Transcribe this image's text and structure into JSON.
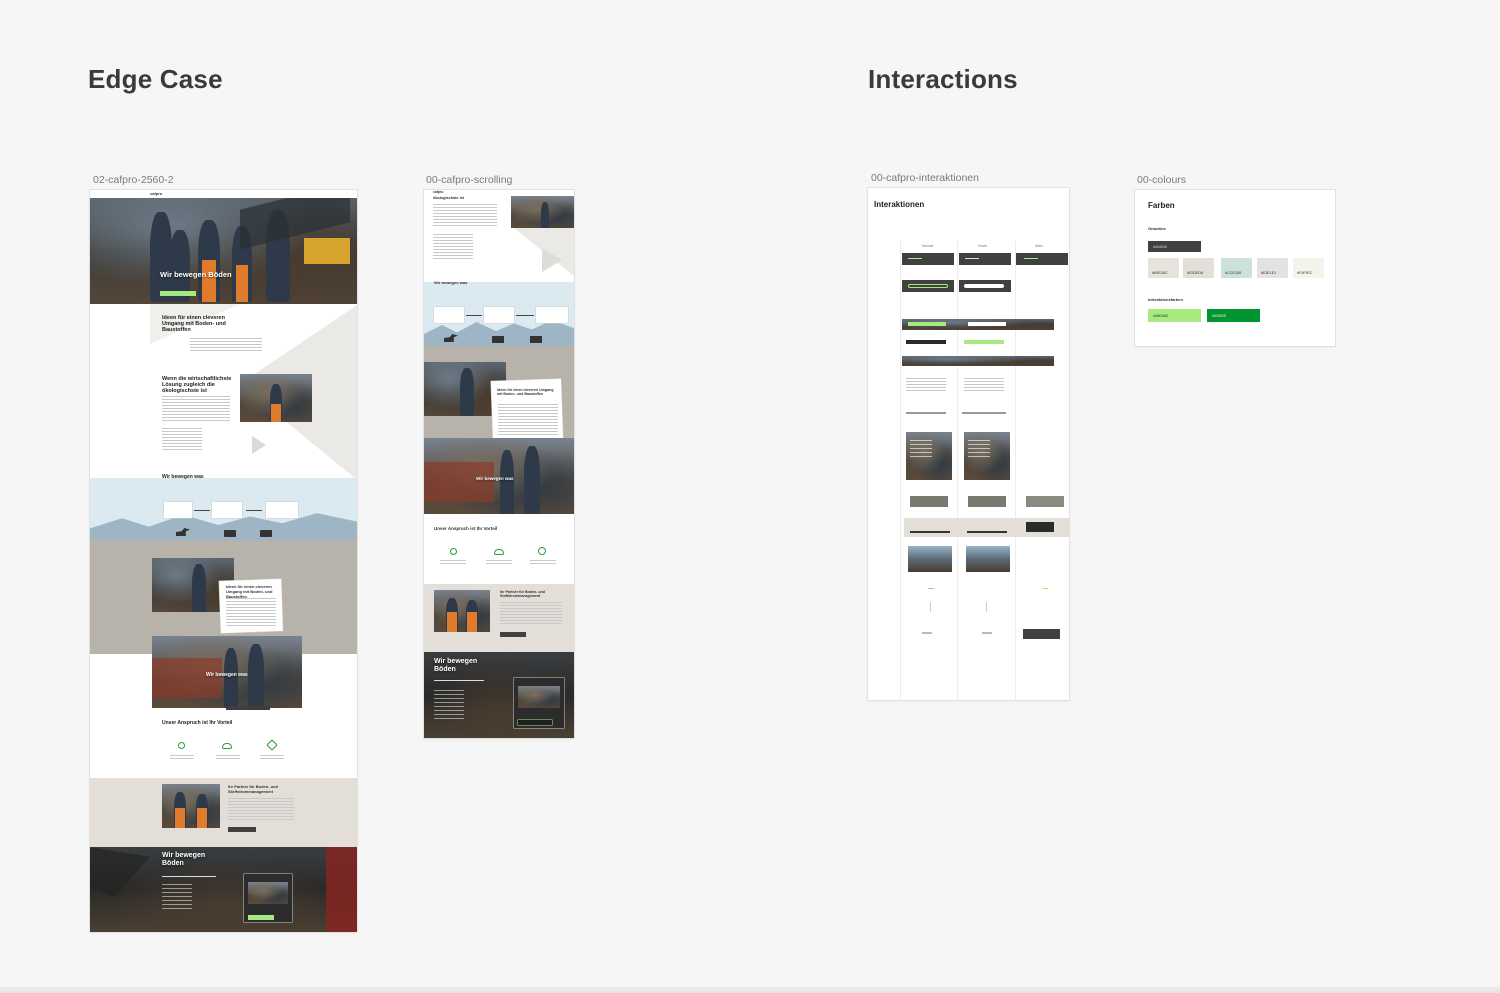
{
  "sections": {
    "edge_case": "Edge Case",
    "interactions": "Interactions"
  },
  "frames": {
    "f1": "02-cafpro-2560-2",
    "f2": "00-cafpro-scrolling",
    "f3": "00-cafpro-interaktionen",
    "f4": "00-colours"
  },
  "site": {
    "logo": "cafpro",
    "hero_title": "Wir bewegen Böden",
    "idea_heading": "Ideen für einen cleveren Umgang mit Boden- und Baustoffen",
    "econ_heading": "Wenn die wirtschaftlichste Lösung zugleich die ökologischste ist",
    "wir_bewegen_was": "Wir bewegen was",
    "anspruch": "Unser Anspruch ist Ihr Vorteil",
    "partner": "Ihr Partner für Boden- und Stoffstrommanagement",
    "footer_title": "Wir bewegen Böden",
    "scroll_heading": "ökologischste ist"
  },
  "interactions_board": {
    "title": "Interaktionen",
    "col_states": [
      "Normal",
      "Hover",
      "Aktiv"
    ]
  },
  "colours_board": {
    "title": "Farben",
    "group1": "Grautöne",
    "group2": "Interaktionsfarben",
    "greys": [
      {
        "hex": "#404040",
        "color": "#404040",
        "label": "#404040"
      },
      {
        "hex": "#E6E4DC",
        "color": "#e6e4dc",
        "label": "#E6E4DC"
      },
      {
        "hex": "#E2DED8",
        "color": "#e2ded8",
        "label": "#E2DED8"
      },
      {
        "hex": "#CCE2D8",
        "color": "#cce2d8",
        "label": "#CCE2D8"
      },
      {
        "hex": "#E3E1E1",
        "color": "#e3e1e1",
        "label": "#E3E1E1"
      },
      {
        "hex": "#F4F3EC",
        "color": "#f4f3ec",
        "label": "#F4F3EC"
      }
    ],
    "interaction": [
      {
        "hex": "#A6EA80",
        "color": "#a6ea80",
        "label": "#A6EA80"
      },
      {
        "hex": "#00952E",
        "color": "#00952e",
        "label": "#00952E"
      }
    ]
  }
}
